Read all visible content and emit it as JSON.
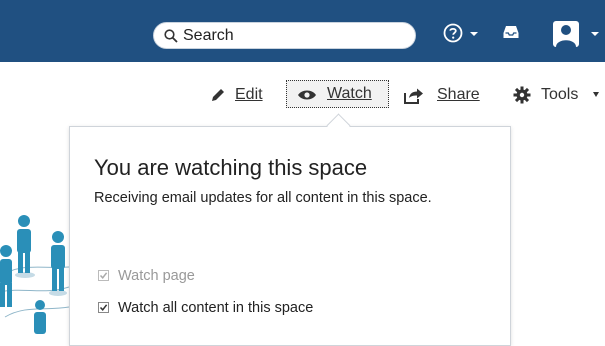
{
  "header": {
    "search_placeholder": "Search",
    "icons": [
      "search-icon",
      "help-icon",
      "inbox-icon",
      "user-icon"
    ]
  },
  "toolbar": {
    "edit_label": "Edit",
    "watch_label": "Watch",
    "share_label": "Share",
    "tools_label": "Tools"
  },
  "popup": {
    "title": "You are watching this space",
    "description": "Receiving email updates for all content in this space.",
    "options": [
      {
        "label": "Watch page",
        "checked": true,
        "disabled": true
      },
      {
        "label": "Watch all content in this space",
        "checked": true,
        "disabled": false
      }
    ]
  },
  "colors": {
    "header_bg": "#205081",
    "popup_border": "#cfd4da",
    "accent_teal": "#2a8fb8"
  }
}
